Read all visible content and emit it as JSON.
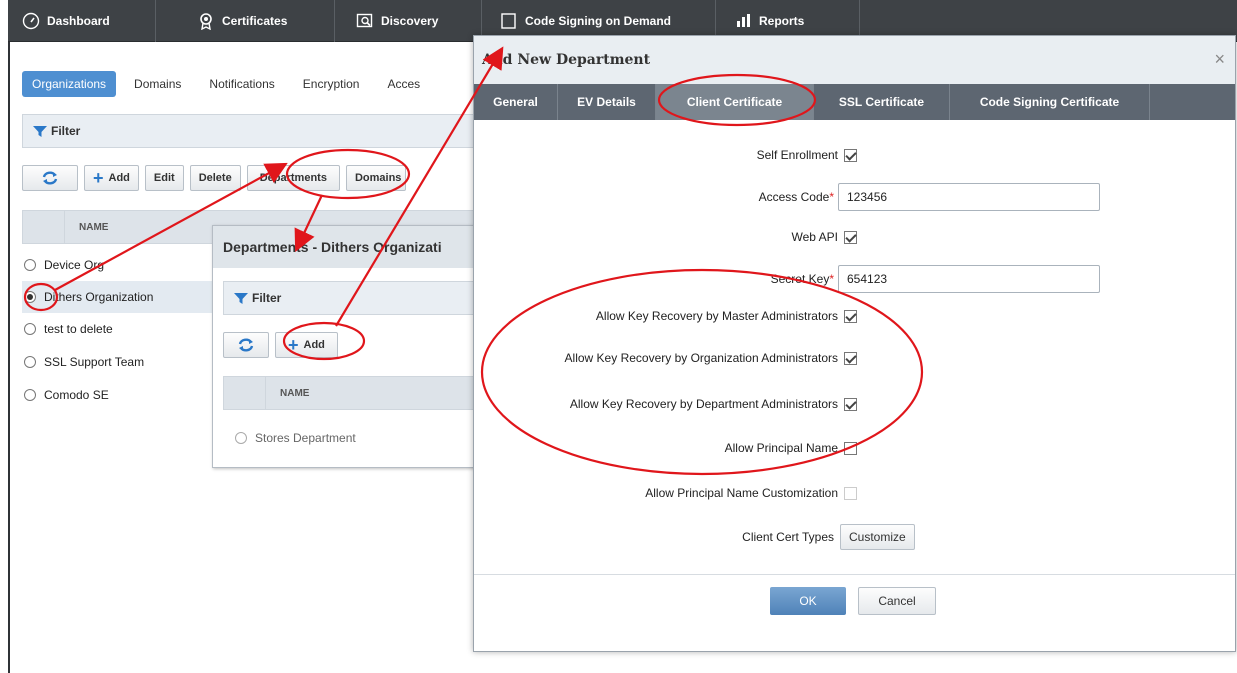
{
  "topnav": {
    "tabs": [
      {
        "label": "Dashboard",
        "icon": "gauge-icon"
      },
      {
        "label": "Certificates",
        "icon": "certificate-icon"
      },
      {
        "label": "Discovery",
        "icon": "discovery-icon"
      },
      {
        "label": "Code Signing on Demand",
        "icon": "code-signing-icon"
      },
      {
        "label": "Reports",
        "icon": "reports-icon"
      }
    ]
  },
  "subtabs": [
    "Organizations",
    "Domains",
    "Notifications",
    "Encryption",
    "Acces"
  ],
  "org_panel": {
    "filter_label": "Filter",
    "toolbar": {
      "add": "Add",
      "edit": "Edit",
      "delete": "Delete",
      "departments": "Departments",
      "domains": "Domains"
    },
    "column_name": "NAME",
    "rows": [
      "Device Org",
      "Dithers Organization",
      "test to delete",
      "SSL Support Team",
      "Comodo SE"
    ],
    "selected_index": 1
  },
  "dept_dialog": {
    "title": "Departments - Dithers Organizati",
    "filter_label": "Filter",
    "add_label": "Add",
    "column_name": "NAME",
    "rows": [
      "Stores Department"
    ]
  },
  "modal": {
    "title": "Add New Department",
    "close_glyph": "×",
    "tabs": [
      "General",
      "EV Details",
      "Client Certificate",
      "SSL Certificate",
      "Code Signing Certificate"
    ],
    "active_tab": 2,
    "fields": {
      "self_enrollment": {
        "label": "Self Enrollment",
        "checked": true
      },
      "access_code": {
        "label": "Access Code",
        "required_mark": "*",
        "value": "123456"
      },
      "web_api": {
        "label": "Web API",
        "checked": true
      },
      "secret_key": {
        "label": "Secret Key",
        "required_mark": "*",
        "value": "654123"
      },
      "key_recovery_master": {
        "label": "Allow Key Recovery by Master Administrators",
        "checked": true
      },
      "key_recovery_org": {
        "label": "Allow Key Recovery by Organization Administrators",
        "checked": true
      },
      "key_recovery_dept": {
        "label": "Allow Key Recovery by Department Administrators",
        "checked": true
      },
      "principal_name": {
        "label": "Allow Principal Name",
        "checked": false
      },
      "principal_name_custom": {
        "label": "Allow Principal Name Customization",
        "checked": false
      },
      "client_cert_types": {
        "label": "Client Cert Types",
        "button": "Customize"
      }
    },
    "ok_label": "OK",
    "cancel_label": "Cancel"
  },
  "annotation_color": "#e0161b"
}
